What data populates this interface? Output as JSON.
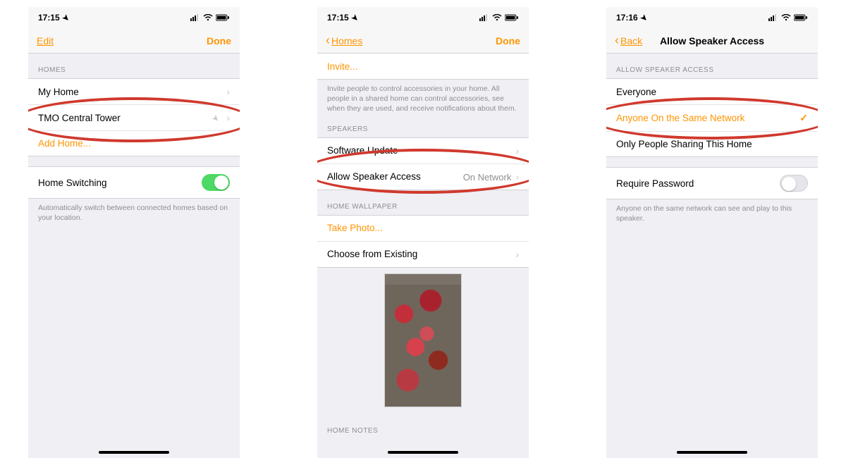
{
  "status": {
    "time1": "17:15",
    "time2": "17:15",
    "time3": "17:16"
  },
  "screen1": {
    "nav": {
      "left": "Edit",
      "right": "Done"
    },
    "sections": {
      "homes_header": "HOMES",
      "home1": "My Home",
      "home2": "TMO Central Tower",
      "add_home": "Add Home..."
    },
    "switching": {
      "label": "Home Switching",
      "footer": "Automatically switch between connected homes based on your location."
    }
  },
  "screen2": {
    "nav": {
      "back": "Homes",
      "right": "Done"
    },
    "invite": {
      "label": "Invite...",
      "footer": "Invite people to control accessories in your home. All people in a shared home can control accessories, see when they are used, and receive notifications about them."
    },
    "speakers_header": "SPEAKERS",
    "software_update": "Software Update",
    "allow_speaker": {
      "label": "Allow Speaker Access",
      "value": "On Network"
    },
    "wallpaper_header": "HOME WALLPAPER",
    "take_photo": "Take Photo...",
    "choose_existing": "Choose from Existing",
    "notes_header": "HOME NOTES"
  },
  "screen3": {
    "nav": {
      "back": "Back",
      "title": "Allow Speaker Access"
    },
    "section_header": "ALLOW SPEAKER ACCESS",
    "opt1": "Everyone",
    "opt2": "Anyone On the Same Network",
    "opt3": "Only People Sharing This Home",
    "require_pw": "Require Password",
    "footer": "Anyone on the same network can see and play to this speaker."
  }
}
